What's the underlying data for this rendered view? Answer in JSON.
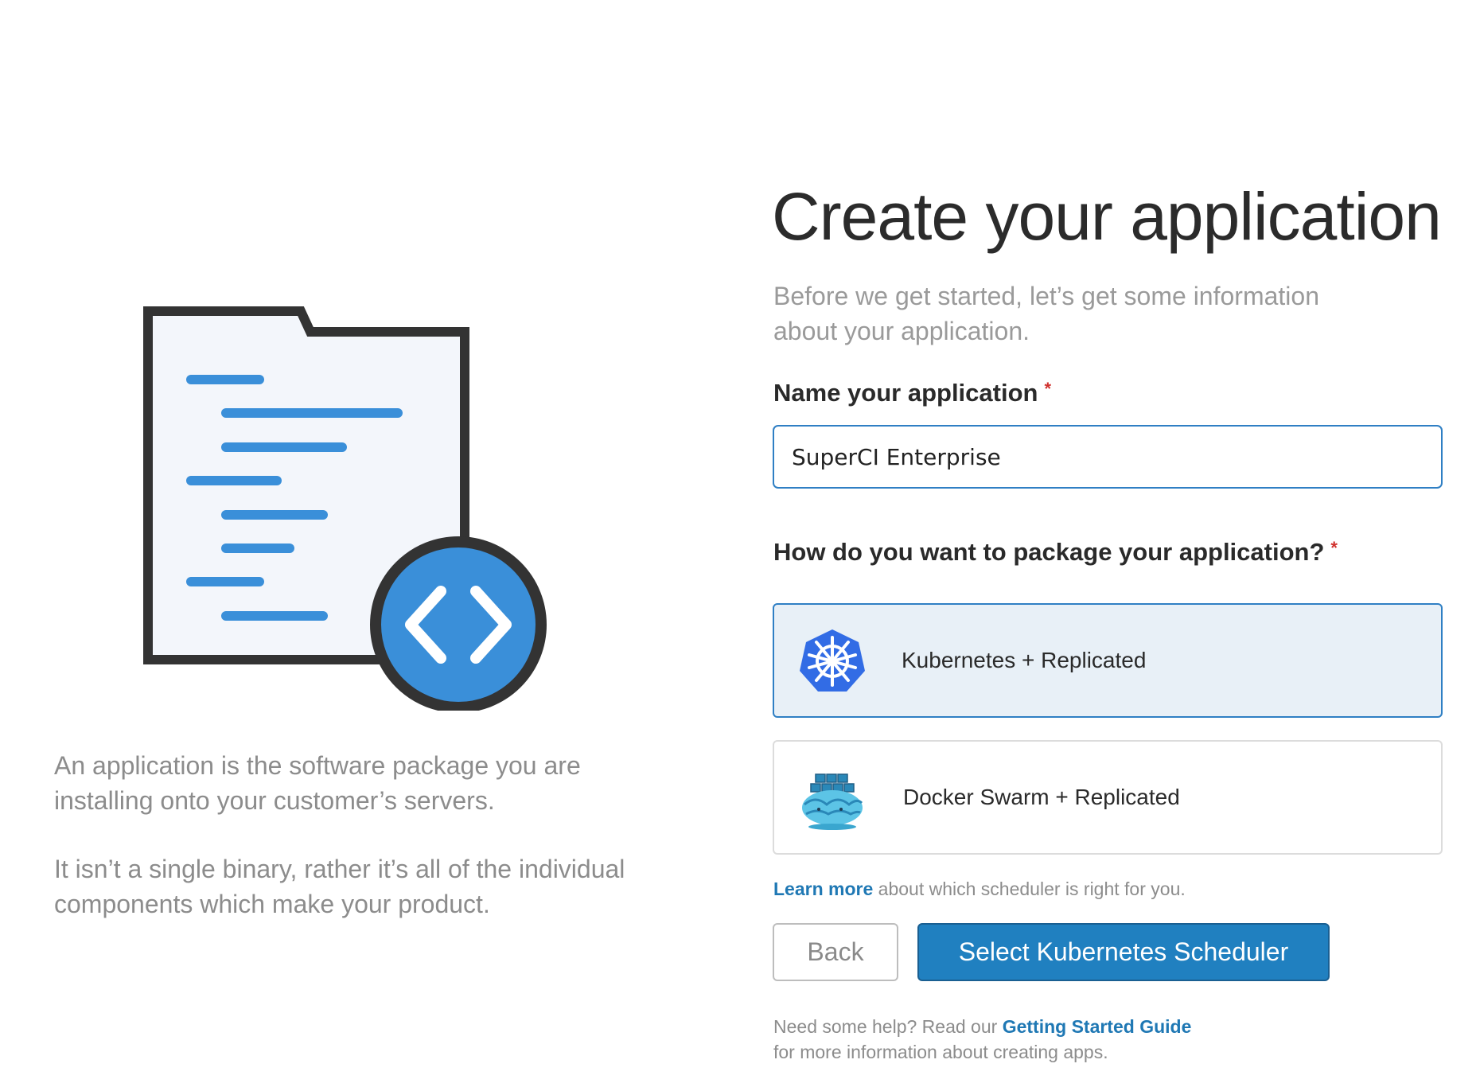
{
  "left": {
    "description_paragraphs": [
      "An application is the software package you are installing onto your customer’s servers.",
      "It isn’t a single binary, rather it’s all of the individual components which make your product."
    ]
  },
  "header": {
    "title": "Create your application",
    "subtitle": "Before we get started, let’s get some information about your application."
  },
  "form": {
    "name_label": "Name your application",
    "required_marker": "*",
    "name_value": "SuperCI Enterprise",
    "package_label": "How do you want to package your application?",
    "options": [
      {
        "label": "Kubernetes + Replicated",
        "icon": "kubernetes-icon",
        "selected": true
      },
      {
        "label": "Docker Swarm + Replicated",
        "icon": "docker-swarm-icon",
        "selected": false
      }
    ]
  },
  "learn_more": {
    "link": "Learn more",
    "text": " about which scheduler is right for you."
  },
  "buttons": {
    "back": "Back",
    "primary": "Select Kubernetes Scheduler"
  },
  "help": {
    "prefix": "Need some help? Read our ",
    "link": "Getting Started Guide",
    "suffix": "for more information about creating apps."
  },
  "colors": {
    "accent": "#2080c0",
    "selected_bg": "#e8f0f7",
    "required": "#d0312d",
    "muted_text": "#8c8c8c"
  }
}
